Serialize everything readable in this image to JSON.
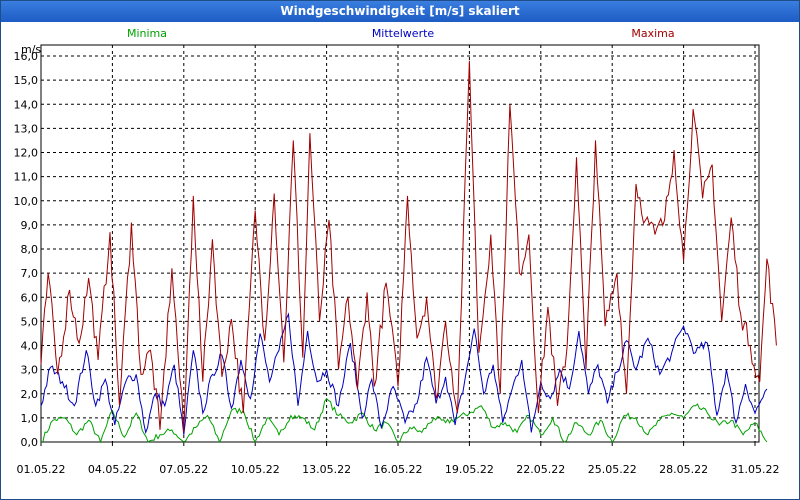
{
  "window": {
    "title": "Windgeschwindigkeit [m/s] skaliert"
  },
  "colors": {
    "minima": "#00a000",
    "mittelwerte": "#0000c0",
    "maxima": "#a00000",
    "grid": "#000000"
  },
  "chart_data": {
    "type": "line",
    "title": "Windgeschwindigkeit [m/s] skaliert",
    "ylabel": "m/s",
    "ylim": [
      0,
      16
    ],
    "y_ticks": [
      "0,0",
      "1,0",
      "2,0",
      "3,0",
      "4,0",
      "5,0",
      "6,0",
      "7,0",
      "8,0",
      "9,0",
      "10,0",
      "11,0",
      "12,0",
      "13,0",
      "14,0",
      "15,0",
      "16,0"
    ],
    "x_ticks": [
      "01.05.22",
      "04.05.22",
      "07.05.22",
      "10.05.22",
      "13.05.22",
      "16.05.22",
      "19.05.22",
      "22.05.22",
      "25.05.22",
      "28.05.22",
      "31.05.22"
    ],
    "grid": true,
    "legend_position": "top",
    "series": [
      {
        "name": "Minima",
        "color": "#00a000",
        "peaks": [
          [
            0.0,
            0.0
          ],
          [
            0.5,
            0.9
          ],
          [
            1.0,
            1.0
          ],
          [
            1.5,
            0.3
          ],
          [
            2.0,
            0.9
          ],
          [
            2.5,
            0.0
          ],
          [
            3.0,
            1.3
          ],
          [
            3.5,
            0.2
          ],
          [
            4.0,
            1.2
          ],
          [
            4.5,
            0.0
          ],
          [
            5.0,
            0.3
          ],
          [
            5.5,
            0.5
          ],
          [
            6.0,
            0.0
          ],
          [
            6.5,
            0.6
          ],
          [
            7.0,
            1.1
          ],
          [
            7.5,
            0.0
          ],
          [
            8.0,
            1.3
          ],
          [
            8.5,
            1.3
          ],
          [
            9.0,
            0.0
          ],
          [
            9.5,
            1.0
          ],
          [
            10.0,
            0.3
          ],
          [
            10.5,
            1.1
          ],
          [
            11.0,
            1.0
          ],
          [
            11.5,
            0.5
          ],
          [
            12.0,
            1.8
          ],
          [
            12.5,
            1.1
          ],
          [
            13.0,
            0.8
          ],
          [
            13.5,
            1.2
          ],
          [
            14.0,
            0.5
          ],
          [
            14.5,
            0.8
          ],
          [
            15.0,
            0.0
          ],
          [
            15.5,
            0.6
          ],
          [
            16.0,
            0.4
          ],
          [
            16.5,
            1.0
          ],
          [
            17.0,
            0.8
          ],
          [
            17.5,
            1.0
          ],
          [
            18.0,
            1.2
          ],
          [
            18.5,
            1.5
          ],
          [
            19.0,
            0.6
          ],
          [
            19.5,
            0.8
          ],
          [
            20.0,
            0.4
          ],
          [
            20.5,
            1.1
          ],
          [
            21.0,
            0.3
          ],
          [
            21.5,
            1.0
          ],
          [
            22.0,
            0.0
          ],
          [
            22.5,
            0.8
          ],
          [
            23.0,
            0.3
          ],
          [
            23.5,
            0.9
          ],
          [
            24.0,
            0.0
          ],
          [
            24.5,
            1.1
          ],
          [
            25.0,
            1.0
          ],
          [
            25.5,
            0.3
          ],
          [
            26.0,
            0.9
          ],
          [
            26.5,
            1.2
          ],
          [
            27.0,
            1.0
          ],
          [
            27.5,
            1.5
          ],
          [
            28.0,
            1.2
          ],
          [
            28.5,
            0.7
          ],
          [
            29.0,
            0.9
          ],
          [
            29.5,
            0.3
          ],
          [
            30.0,
            0.8
          ],
          [
            30.5,
            0.0
          ]
        ]
      },
      {
        "name": "Mittelwerte",
        "color": "#0000c0",
        "peaks": [
          [
            0.0,
            1.5
          ],
          [
            0.4,
            3.1
          ],
          [
            0.9,
            2.5
          ],
          [
            1.4,
            1.5
          ],
          [
            1.9,
            3.8
          ],
          [
            2.3,
            1.5
          ],
          [
            2.7,
            2.6
          ],
          [
            3.1,
            0.7
          ],
          [
            3.6,
            2.6
          ],
          [
            4.0,
            2.8
          ],
          [
            4.4,
            0.4
          ],
          [
            4.8,
            2.0
          ],
          [
            5.2,
            1.5
          ],
          [
            5.6,
            3.2
          ],
          [
            6.0,
            0.3
          ],
          [
            6.4,
            3.8
          ],
          [
            6.8,
            1.2
          ],
          [
            7.2,
            2.8
          ],
          [
            7.6,
            3.6
          ],
          [
            8.0,
            1.4
          ],
          [
            8.4,
            3.4
          ],
          [
            8.8,
            1.8
          ],
          [
            9.2,
            4.5
          ],
          [
            9.6,
            2.5
          ],
          [
            10.0,
            3.8
          ],
          [
            10.4,
            5.3
          ],
          [
            10.8,
            1.5
          ],
          [
            11.2,
            4.6
          ],
          [
            11.6,
            2.5
          ],
          [
            12.0,
            3.0
          ],
          [
            12.5,
            1.5
          ],
          [
            13.0,
            4.1
          ],
          [
            13.5,
            1.0
          ],
          [
            13.9,
            2.6
          ],
          [
            14.3,
            0.6
          ],
          [
            14.8,
            2.3
          ],
          [
            15.3,
            0.8
          ],
          [
            15.8,
            1.6
          ],
          [
            16.2,
            3.5
          ],
          [
            16.6,
            1.6
          ],
          [
            17.0,
            2.7
          ],
          [
            17.4,
            0.7
          ],
          [
            17.8,
            2.5
          ],
          [
            18.2,
            4.7
          ],
          [
            18.6,
            2.0
          ],
          [
            19.0,
            3.2
          ],
          [
            19.4,
            0.8
          ],
          [
            19.8,
            2.2
          ],
          [
            20.2,
            3.4
          ],
          [
            20.6,
            0.4
          ],
          [
            21.0,
            2.5
          ],
          [
            21.4,
            1.8
          ],
          [
            21.8,
            3.0
          ],
          [
            22.2,
            2.2
          ],
          [
            22.6,
            4.6
          ],
          [
            23.0,
            2.0
          ],
          [
            23.4,
            3.2
          ],
          [
            23.8,
            1.6
          ],
          [
            24.2,
            2.9
          ],
          [
            24.6,
            4.2
          ],
          [
            25.0,
            3.0
          ],
          [
            25.5,
            4.3
          ],
          [
            26.0,
            2.8
          ],
          [
            26.5,
            3.7
          ],
          [
            27.0,
            4.8
          ],
          [
            27.5,
            3.7
          ],
          [
            28.0,
            4.1
          ],
          [
            28.4,
            1.1
          ],
          [
            28.8,
            3.0
          ],
          [
            29.2,
            0.8
          ],
          [
            29.6,
            2.4
          ],
          [
            30.0,
            1.2
          ],
          [
            30.5,
            2.2
          ]
        ]
      },
      {
        "name": "Maxima",
        "color": "#a00000",
        "peaks": [
          [
            0.0,
            3.2
          ],
          [
            0.3,
            7.0
          ],
          [
            0.7,
            2.8
          ],
          [
            1.2,
            6.3
          ],
          [
            1.6,
            4.1
          ],
          [
            2.0,
            6.8
          ],
          [
            2.4,
            3.4
          ],
          [
            2.9,
            8.7
          ],
          [
            3.3,
            1.5
          ],
          [
            3.8,
            9.1
          ],
          [
            4.2,
            2.8
          ],
          [
            4.6,
            3.8
          ],
          [
            5.0,
            0.5
          ],
          [
            5.5,
            7.2
          ],
          [
            6.0,
            0.4
          ],
          [
            6.4,
            10.2
          ],
          [
            6.8,
            2.5
          ],
          [
            7.2,
            8.4
          ],
          [
            7.6,
            2.7
          ],
          [
            8.0,
            5.1
          ],
          [
            8.5,
            1.2
          ],
          [
            9.0,
            9.6
          ],
          [
            9.4,
            4.2
          ],
          [
            9.8,
            10.3
          ],
          [
            10.2,
            3.3
          ],
          [
            10.6,
            12.5
          ],
          [
            11.0,
            3.5
          ],
          [
            11.3,
            12.8
          ],
          [
            11.7,
            5.0
          ],
          [
            12.1,
            9.2
          ],
          [
            12.5,
            3.0
          ],
          [
            12.9,
            6.0
          ],
          [
            13.3,
            2.2
          ],
          [
            13.7,
            6.2
          ],
          [
            14.0,
            2.3
          ],
          [
            14.5,
            6.6
          ],
          [
            15.0,
            2.3
          ],
          [
            15.4,
            10.2
          ],
          [
            15.8,
            4.3
          ],
          [
            16.2,
            6.0
          ],
          [
            16.6,
            1.8
          ],
          [
            17.0,
            5.0
          ],
          [
            17.5,
            1.2
          ],
          [
            18.0,
            15.8
          ],
          [
            18.4,
            3.7
          ],
          [
            18.9,
            8.6
          ],
          [
            19.3,
            2.0
          ],
          [
            19.7,
            14.0
          ],
          [
            20.1,
            7.0
          ],
          [
            20.5,
            8.6
          ],
          [
            20.9,
            1.2
          ],
          [
            21.3,
            5.6
          ],
          [
            21.7,
            1.5
          ],
          [
            22.1,
            3.9
          ],
          [
            22.5,
            11.8
          ],
          [
            22.9,
            3.0
          ],
          [
            23.3,
            12.5
          ],
          [
            23.7,
            4.8
          ],
          [
            24.2,
            7.0
          ],
          [
            24.6,
            2.0
          ],
          [
            25.0,
            10.7
          ],
          [
            25.4,
            9.2
          ],
          [
            25.8,
            8.6
          ],
          [
            26.2,
            9.2
          ],
          [
            26.6,
            12.1
          ],
          [
            27.0,
            7.5
          ],
          [
            27.4,
            13.8
          ],
          [
            27.8,
            10.1
          ],
          [
            28.2,
            11.5
          ],
          [
            28.6,
            5.0
          ],
          [
            29.0,
            9.3
          ],
          [
            29.4,
            5.3
          ],
          [
            29.8,
            4.0
          ],
          [
            30.2,
            2.5
          ],
          [
            30.5,
            7.6
          ],
          [
            30.9,
            4.0
          ]
        ]
      }
    ]
  }
}
